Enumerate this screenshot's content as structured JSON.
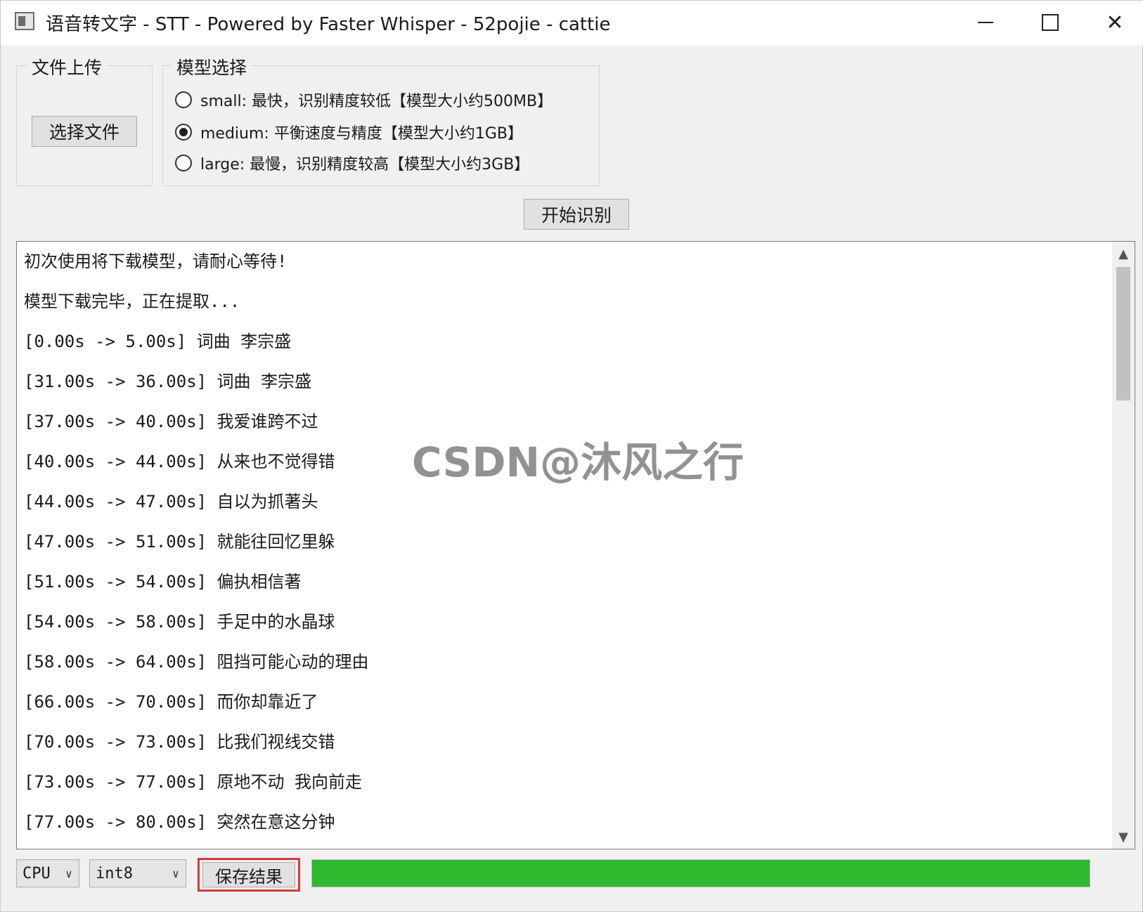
{
  "window": {
    "title": "语音转文字 - STT - Powered by Faster Whisper - 52pojie - cattie"
  },
  "upload": {
    "group_title": "文件上传",
    "choose_button": "选择文件"
  },
  "model": {
    "group_title": "模型选择",
    "options": [
      {
        "label": "small: 最快，识别精度较低【模型大小约500MB】",
        "checked": false
      },
      {
        "label": "medium: 平衡速度与精度【模型大小约1GB】",
        "checked": true
      },
      {
        "label": "large: 最慢，识别精度较高【模型大小约3GB】",
        "checked": false
      }
    ]
  },
  "start_button": "开始识别",
  "output": {
    "lines": [
      "初次使用将下载模型，请耐心等待!",
      "模型下载完毕，正在提取...",
      "[0.00s -> 5.00s] 词曲 李宗盛",
      "[31.00s -> 36.00s] 词曲 李宗盛",
      "[37.00s -> 40.00s] 我爱谁跨不过",
      "[40.00s -> 44.00s] 从来也不觉得错",
      "[44.00s -> 47.00s] 自以为抓著头",
      "[47.00s -> 51.00s] 就能往回忆里躲",
      "[51.00s -> 54.00s] 偏执相信著",
      "[54.00s -> 58.00s] 手足中的水晶球",
      "[58.00s -> 64.00s] 阻挡可能心动的理由",
      "[66.00s -> 70.00s] 而你却靠近了",
      "[70.00s -> 73.00s] 比我们视线交错",
      "[73.00s -> 77.00s] 原地不动 我向前走",
      "[77.00s -> 80.00s] 突然在意这分钟"
    ]
  },
  "watermark": "CSDN@沐风之行",
  "bottom": {
    "device": "CPU",
    "compute_type": "int8",
    "save_button": "保存结果",
    "progress_fraction": 1.0,
    "progress_color": "#2eb82e",
    "highlight_color": "#d23c3c"
  },
  "icons": {
    "minimize": "minimize-icon",
    "maximize": "maximize-icon",
    "close": "close-icon",
    "dropdown": "chevron-down-icon",
    "scroll_up": "scroll-up-icon",
    "scroll_down": "scroll-down-icon"
  }
}
